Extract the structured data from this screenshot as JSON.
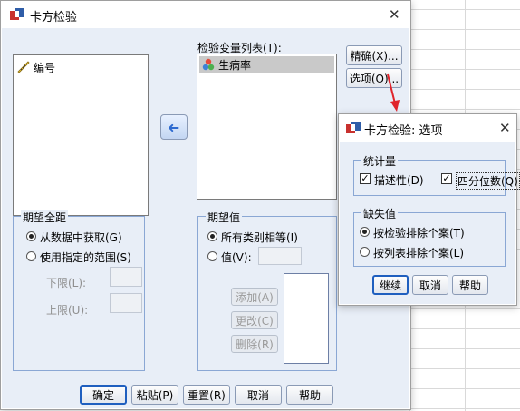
{
  "main_dialog": {
    "title": "卡方检验",
    "close_glyph": "✕",
    "source_list": [
      {
        "label": "编号",
        "icon": "ruler-icon"
      }
    ],
    "test_list_label": "检验变量列表(T):",
    "test_list": [
      {
        "label": "生病率",
        "icon": "nominal-variable-icon",
        "selected": true
      }
    ],
    "move_arrow_glyph": "➜",
    "exact_button": "精确(X)...",
    "options_button": "选项(O)...",
    "expected_range": {
      "legend": "期望全距",
      "from_data": "从数据中获取(G)",
      "use_range": "使用指定的范围(S)",
      "lower": "下限(L):",
      "upper": "上限(U):",
      "selected": "from_data"
    },
    "expected_values": {
      "legend": "期望值",
      "all_equal": "所有类别相等(I)",
      "value": "值(V):",
      "add": "添加(A)",
      "change": "更改(C)",
      "remove": "删除(R)",
      "selected": "all_equal"
    },
    "footer_buttons": {
      "ok": "确定",
      "paste": "粘贴(P)",
      "reset": "重置(R)",
      "cancel": "取消",
      "help": "帮助"
    }
  },
  "options_dialog": {
    "title": "卡方检验: 选项",
    "close_glyph": "✕",
    "statistics": {
      "legend": "统计量",
      "descriptive": "描述性(D)",
      "quartiles": "四分位数(Q)",
      "descriptive_checked": true,
      "quartiles_checked": true
    },
    "missing": {
      "legend": "缺失值",
      "by_test": "按检验排除个案(T)",
      "listwise": "按列表排除个案(L)",
      "selected": "by_test"
    },
    "buttons": {
      "continue": "继续",
      "cancel": "取消",
      "help": "帮助"
    }
  },
  "colors": {
    "accent": "#1f5fbf",
    "panel": "#e8eef7",
    "arrow_annotation": "#e0242b"
  }
}
